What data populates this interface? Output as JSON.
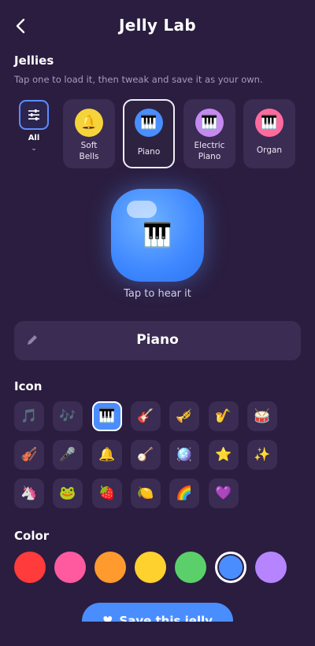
{
  "header": {
    "title": "Jelly Lab",
    "back_icon": "chevron-left-icon"
  },
  "jellies": {
    "title": "Jellies",
    "subtitle": "Tap one to load it, then tweak and save it as your own.",
    "filter": {
      "label": "All",
      "caret": "⌄",
      "icon": "sliders-icon"
    },
    "presets": [
      {
        "label": "Soft Bells",
        "emoji": "🔔",
        "color": "#f5d33b",
        "selected": false
      },
      {
        "label": "Piano",
        "emoji": "🎹",
        "color": "#4a8dff",
        "selected": true
      },
      {
        "label": "Electric Piano",
        "emoji": "🎹",
        "color": "#c48af0",
        "selected": false
      },
      {
        "label": "Organ",
        "emoji": "🎹",
        "color": "#ff6b9d",
        "selected": false
      }
    ]
  },
  "preview": {
    "emoji": "🎹",
    "hint": "Tap to hear it",
    "color": "#4a8dff"
  },
  "name_field": {
    "value": "Piano",
    "icon": "pencil-icon"
  },
  "icons": {
    "title": "Icon",
    "items": [
      "🎵",
      "🎶",
      "🎹",
      "🎸",
      "🎺",
      "🎷",
      "🥁",
      "🎻",
      "🎤",
      "🔔",
      "🪕",
      "🪩",
      "⭐",
      "✨",
      "🦄",
      "🐸",
      "🍓",
      "🍋",
      "🌈",
      "💜"
    ],
    "selected": "🎹"
  },
  "colors": {
    "title": "Color",
    "swatches": [
      "#ff3b3b",
      "#ff5aa0",
      "#ff9a2e",
      "#ffd12e",
      "#5bd06a",
      "#4a8dff",
      "#b684ff"
    ],
    "selected": "#4a8dff"
  },
  "save_button": {
    "label": "Save this jelly",
    "icon": "heart-icon"
  }
}
